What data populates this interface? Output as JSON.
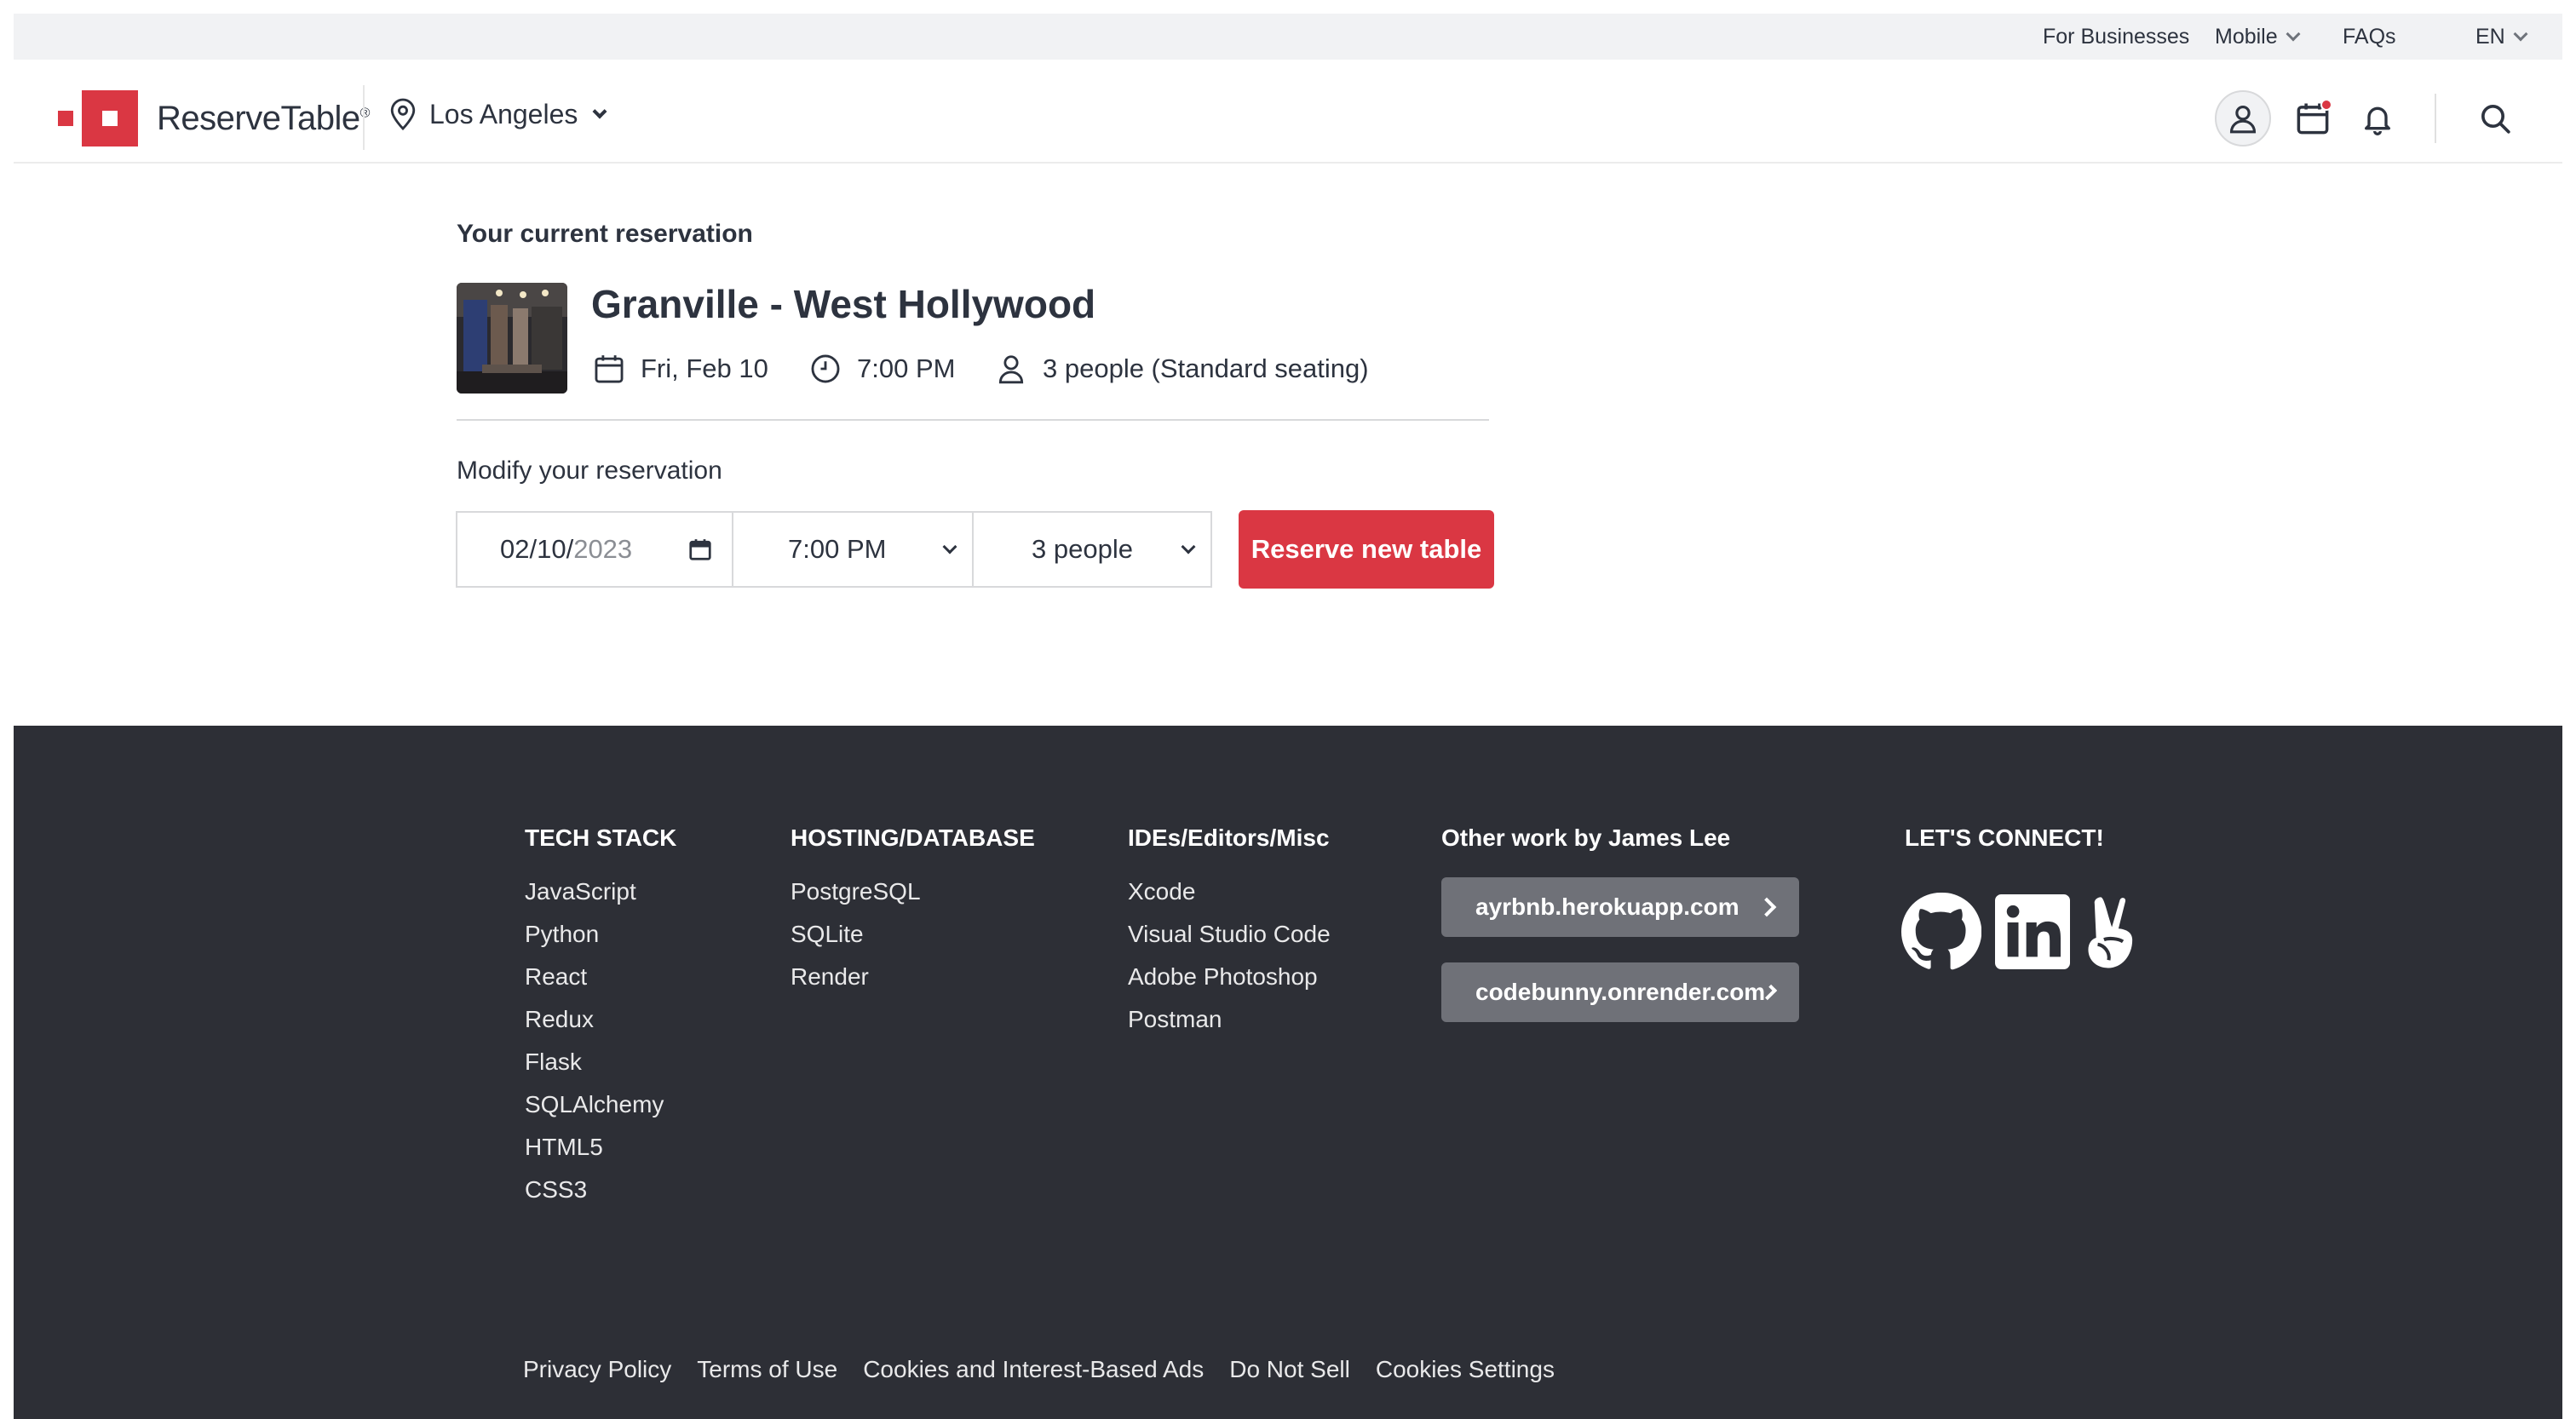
{
  "utility_bar": {
    "for_businesses": "For Businesses",
    "mobile": "Mobile",
    "faqs": "FAQs",
    "language": "EN"
  },
  "header": {
    "brand": "ReserveTable",
    "brand_mark": "®",
    "location": "Los Angeles",
    "icons": [
      "profile-icon",
      "calendar-icon",
      "bell-icon",
      "search-icon"
    ]
  },
  "reservation": {
    "section_label": "Your current reservation",
    "restaurant_name": "Granville - West Hollywood",
    "date": "Fri, Feb 10",
    "time": "7:00 PM",
    "party": "3 people (Standard seating)"
  },
  "modify": {
    "section_label": "Modify your reservation",
    "date_value_md": "02/10/",
    "date_value_year": "2023",
    "time_value": "7:00 PM",
    "party_value": "3 people",
    "reserve_button": "Reserve new table"
  },
  "footer": {
    "columns": [
      {
        "heading": "TECH STACK",
        "items": [
          "JavaScript",
          "Python",
          "React",
          "Redux",
          "Flask",
          "SQLAlchemy",
          "HTML5",
          "CSS3"
        ]
      },
      {
        "heading": "HOSTING/DATABASE",
        "items": [
          "PostgreSQL",
          "SQLite",
          "Render"
        ]
      },
      {
        "heading": "IDEs/Editors/Misc",
        "items": [
          "Xcode",
          "Visual Studio Code",
          "Adobe Photoshop",
          "Postman"
        ]
      }
    ],
    "other_work": {
      "heading": "Other work by James Lee",
      "links": [
        "ayrbnb.herokuapp.com",
        "codebunny.onrender.com"
      ]
    },
    "connect": {
      "heading": "LET'S CONNECT!",
      "icons": [
        "github-icon",
        "linkedin-icon",
        "angellist-icon"
      ]
    },
    "bottom_links": [
      "Privacy Policy",
      "Terms of Use",
      "Cookies and Interest-Based Ads",
      "Do Not Sell",
      "Cookies Settings"
    ]
  },
  "colors": {
    "brand_red": "#da3743",
    "footer_bg": "#2d2f36",
    "utility_bg": "#f1f2f4",
    "link_button_bg": "#6f7178"
  }
}
